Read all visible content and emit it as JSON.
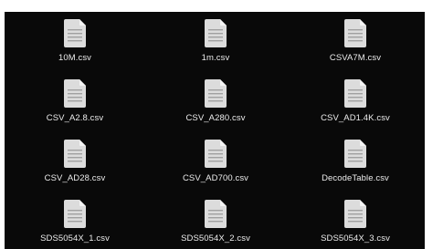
{
  "files": [
    {
      "name": "10M.csv",
      "icon": "document-icon"
    },
    {
      "name": "1m.csv",
      "icon": "document-icon"
    },
    {
      "name": "CSVA7M.csv",
      "icon": "document-icon"
    },
    {
      "name": "CSV_A2.8.csv",
      "icon": "document-icon"
    },
    {
      "name": "CSV_A280.csv",
      "icon": "document-icon"
    },
    {
      "name": "CSV_AD1.4K.csv",
      "icon": "document-icon"
    },
    {
      "name": "CSV_AD28.csv",
      "icon": "document-icon"
    },
    {
      "name": "CSV_AD700.csv",
      "icon": "document-icon"
    },
    {
      "name": "DecodeTable.csv",
      "icon": "document-icon"
    },
    {
      "name": "SDS5054X_1.csv",
      "icon": "document-icon"
    },
    {
      "name": "SDS5054X_2.csv",
      "icon": "document-icon"
    },
    {
      "name": "SDS5054X_3.csv",
      "icon": "document-icon"
    }
  ],
  "colors": {
    "pane_background": "#090909",
    "label_text": "#ececec",
    "icon_page": "#dcdcdc",
    "icon_lines": "#a0a0a0"
  }
}
